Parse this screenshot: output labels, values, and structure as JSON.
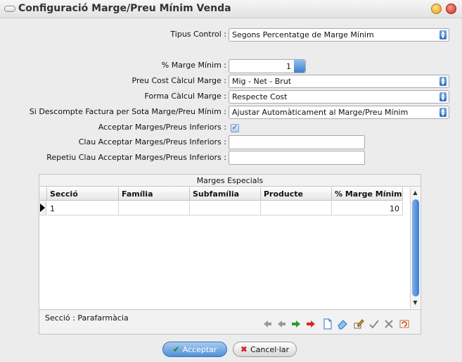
{
  "window": {
    "title": "Configuració Marge/Preu Mínim Venda"
  },
  "form": {
    "tipus_control": {
      "label": "Tipus Control :",
      "value": "Segons Percentatge de Marge Mínim"
    },
    "marge_minim": {
      "label": "% Marge Mínim :",
      "value": "1"
    },
    "preu_cost": {
      "label": "Preu Cost Càlcul Marge :",
      "value": "Mig - Net - Brut"
    },
    "forma_calcul": {
      "label": "Forma Càlcul Marge :",
      "value": "Respecte Cost"
    },
    "descompte_factura": {
      "label": "Si Descompte Factura per Sota Marge/Preu Mínim :",
      "value": "Ajustar Automàticament al Marge/Preu Mínim"
    },
    "acceptar_inferiors": {
      "label": "Acceptar Marges/Preus Inferiors :",
      "checked": true
    },
    "clau_acceptar": {
      "label": "Clau Acceptar Marges/Preus Inferiors :",
      "value": ""
    },
    "repetiu_clau": {
      "label": "Repetiu Clau Acceptar Marges/Preus Inferiors :",
      "value": ""
    }
  },
  "marges": {
    "title": "Marges Especials",
    "columns": [
      "Secció",
      "Família",
      "Subfamília",
      "Producte",
      "% Marge Mínim"
    ],
    "rows": [
      {
        "seccio": "1",
        "familia": "",
        "subfamilia": "",
        "producte": "",
        "marge": "10"
      }
    ],
    "status": "Secció : Parafarmàcia"
  },
  "nav_icons": [
    "first-icon",
    "prev-icon",
    "next-icon",
    "last-icon",
    "new-icon",
    "erase-icon",
    "edit-icon",
    "confirm-icon",
    "cancel-icon",
    "refresh-icon"
  ],
  "buttons": {
    "accept": "Acceptar",
    "cancel": "Cancel·lar"
  },
  "colors": {
    "accent": "#4f8fd8",
    "close": "#c8281e",
    "minimize": "#e09a10"
  }
}
